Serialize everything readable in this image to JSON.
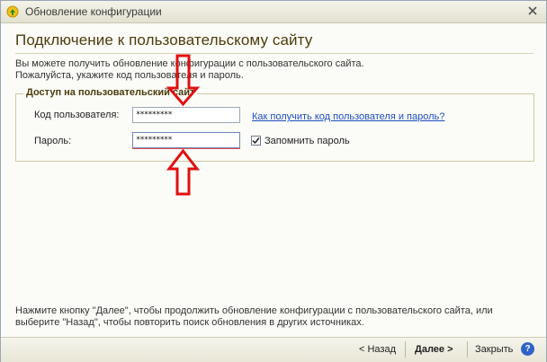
{
  "window": {
    "title": "Обновление конфигурации"
  },
  "page": {
    "heading": "Подключение к пользовательскому сайту",
    "intro_line1": "Вы можете получить обновление конфигурации с пользовательского сайта.",
    "intro_line2": "Пожалуйста,  укажите код пользователя и пароль."
  },
  "group": {
    "title": "Доступ на пользовательский сайт",
    "user_code_label": "Код пользователя:",
    "user_code_value": "*********",
    "password_label": "Пароль:",
    "password_value": "*********",
    "help_link": "Как получить код пользователя и пароль?",
    "remember_label": "Запомнить пароль",
    "remember_checked": true
  },
  "footer": {
    "line1": "Нажмите кнопку \"Далее\", чтобы продолжить обновление конфигурации с пользовательского сайта, или",
    "line2": "выберите \"Назад\", чтобы повторить поиск обновления в других источниках."
  },
  "buttons": {
    "back": "< Назад",
    "next": "Далее >",
    "close": "Закрыть",
    "help": "?"
  },
  "colors": {
    "annotation_arrow": "#e01010",
    "heading": "#4b3c0c",
    "link": "#1c4fbf"
  },
  "icons": {
    "app": "1c-app-icon",
    "close": "close-icon",
    "checkbox": "checkmark-icon",
    "help": "help-icon",
    "annotation": "arrow-annotation"
  }
}
